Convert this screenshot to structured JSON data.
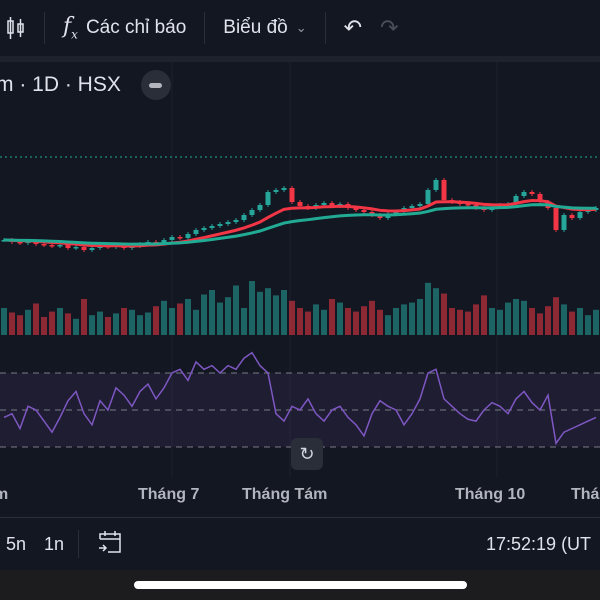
{
  "toolbar": {
    "indicators_label": "Các chỉ báo",
    "chart_label": "Biểu đồ"
  },
  "legend": {
    "symbol_suffix": "m · 1D · HSX"
  },
  "time_axis": [
    "m",
    "Tháng 7",
    "Tháng Tám",
    "Tháng 10",
    "Thá"
  ],
  "bottom_bar": {
    "ranges": [
      "5n",
      "1n"
    ],
    "clock": "17:52:19 (UT"
  },
  "colors": {
    "up": "#26a69a",
    "down": "#f23645",
    "ma_fast": "#f23645",
    "ma_slow": "#22ab94",
    "rsi": "#7e57c2"
  },
  "chart_data": {
    "type": "candlestick",
    "closes": [
      60,
      58,
      57,
      59,
      56,
      55,
      54,
      55,
      52,
      53,
      50,
      52,
      54,
      53,
      55,
      52,
      54,
      56,
      58,
      57,
      60,
      63,
      62,
      66,
      70,
      72,
      74,
      76,
      78,
      80,
      85,
      90,
      95,
      108,
      110,
      112,
      98,
      94,
      92,
      95,
      97,
      94,
      96,
      92,
      90,
      88,
      85,
      82,
      86,
      88,
      92,
      94,
      96,
      110,
      120,
      100,
      98,
      96,
      95,
      92,
      90,
      93,
      95,
      96,
      104,
      108,
      106,
      98,
      92,
      70,
      85,
      82,
      88,
      90,
      92
    ],
    "volumes": [
      30,
      25,
      22,
      28,
      35,
      20,
      26,
      30,
      24,
      18,
      40,
      22,
      26,
      20,
      24,
      30,
      28,
      22,
      25,
      32,
      38,
      30,
      35,
      40,
      28,
      45,
      50,
      36,
      42,
      55,
      30,
      60,
      48,
      52,
      44,
      50,
      38,
      30,
      26,
      34,
      28,
      40,
      36,
      30,
      26,
      32,
      38,
      28,
      22,
      30,
      34,
      36,
      40,
      58,
      52,
      46,
      30,
      28,
      26,
      34,
      44,
      30,
      28,
      36,
      40,
      38,
      30,
      24,
      32,
      42,
      34,
      26,
      30,
      22,
      28
    ],
    "rsi": [
      46,
      48,
      40,
      52,
      50,
      44,
      38,
      46,
      55,
      60,
      48,
      42,
      55,
      50,
      62,
      58,
      52,
      60,
      64,
      56,
      62,
      70,
      72,
      66,
      76,
      72,
      74,
      70,
      74,
      72,
      78,
      81,
      74,
      70,
      48,
      44,
      52,
      50,
      56,
      48,
      44,
      50,
      52,
      46,
      42,
      36,
      48,
      55,
      52,
      50,
      42,
      48,
      56,
      70,
      72,
      56,
      52,
      48,
      45,
      44,
      50,
      54,
      52,
      48,
      56,
      60,
      54,
      50,
      58,
      32,
      38,
      40,
      42,
      44,
      46
    ],
    "rsi_levels": [
      70,
      50,
      30
    ]
  }
}
